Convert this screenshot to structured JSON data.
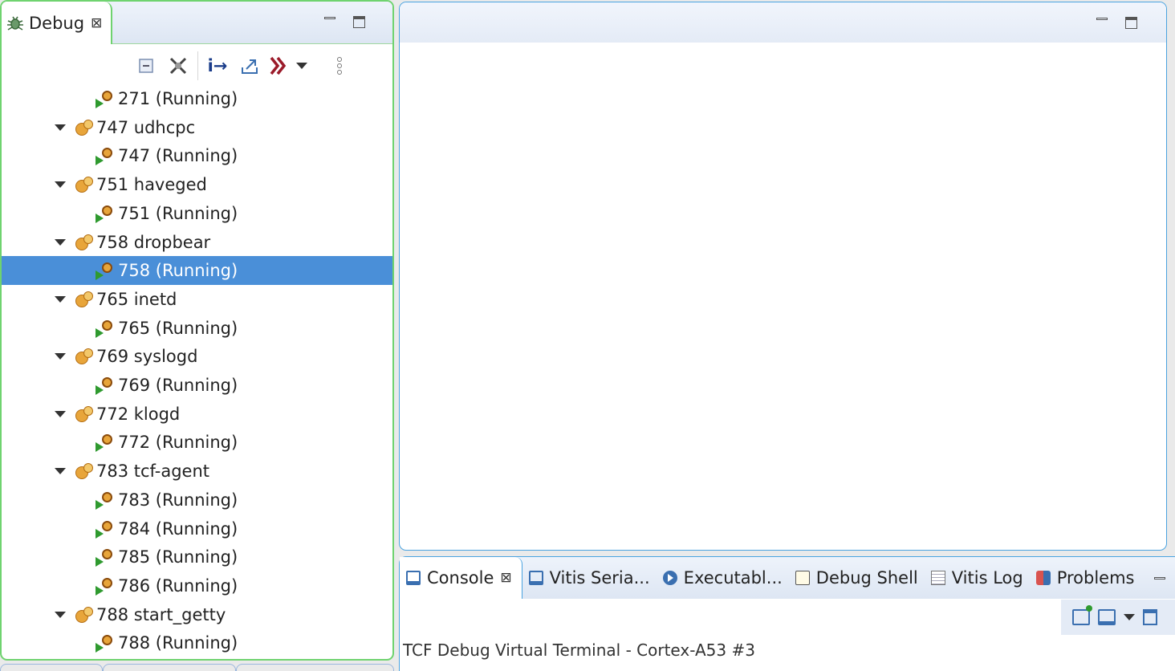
{
  "debug_view": {
    "tab_label": "Debug",
    "tree": [
      {
        "kind": "thread",
        "label": "271 (Running)"
      },
      {
        "kind": "process",
        "label": "747 udhcpc"
      },
      {
        "kind": "thread",
        "label": "747 (Running)"
      },
      {
        "kind": "process",
        "label": "751 haveged"
      },
      {
        "kind": "thread",
        "label": "751 (Running)"
      },
      {
        "kind": "process",
        "label": "758 dropbear"
      },
      {
        "kind": "thread",
        "label": "758 (Running)",
        "selected": true
      },
      {
        "kind": "process",
        "label": "765 inetd"
      },
      {
        "kind": "thread",
        "label": "765 (Running)"
      },
      {
        "kind": "process",
        "label": "769 syslogd"
      },
      {
        "kind": "thread",
        "label": "769 (Running)"
      },
      {
        "kind": "process",
        "label": "772 klogd"
      },
      {
        "kind": "thread",
        "label": "772 (Running)"
      },
      {
        "kind": "process",
        "label": "783 tcf-agent"
      },
      {
        "kind": "thread",
        "label": "783 (Running)"
      },
      {
        "kind": "thread",
        "label": "784 (Running)"
      },
      {
        "kind": "thread",
        "label": "785 (Running)"
      },
      {
        "kind": "thread",
        "label": "786 (Running)"
      },
      {
        "kind": "process",
        "label": "788 start_getty"
      },
      {
        "kind": "thread",
        "label": "788 (Running)"
      }
    ],
    "toolbar": {
      "instruction_step_icon_text": "i→"
    }
  },
  "console_view": {
    "tabs": [
      {
        "label": "Console",
        "icon": "console-icon",
        "active": true
      },
      {
        "label": "Vitis Seria...",
        "icon": "serial-terminal-icon"
      },
      {
        "label": "Executabl...",
        "icon": "executables-icon"
      },
      {
        "label": "Debug Shell",
        "icon": "debug-shell-icon"
      },
      {
        "label": "Vitis Log",
        "icon": "log-icon"
      },
      {
        "label": "Problems",
        "icon": "problems-icon"
      }
    ],
    "title": "TCF Debug Virtual Terminal - Cortex-A53 #3"
  },
  "colors": {
    "debug_border": "#6fd36f",
    "editor_border": "#4aa3e0",
    "selection": "#4a8fd8"
  }
}
